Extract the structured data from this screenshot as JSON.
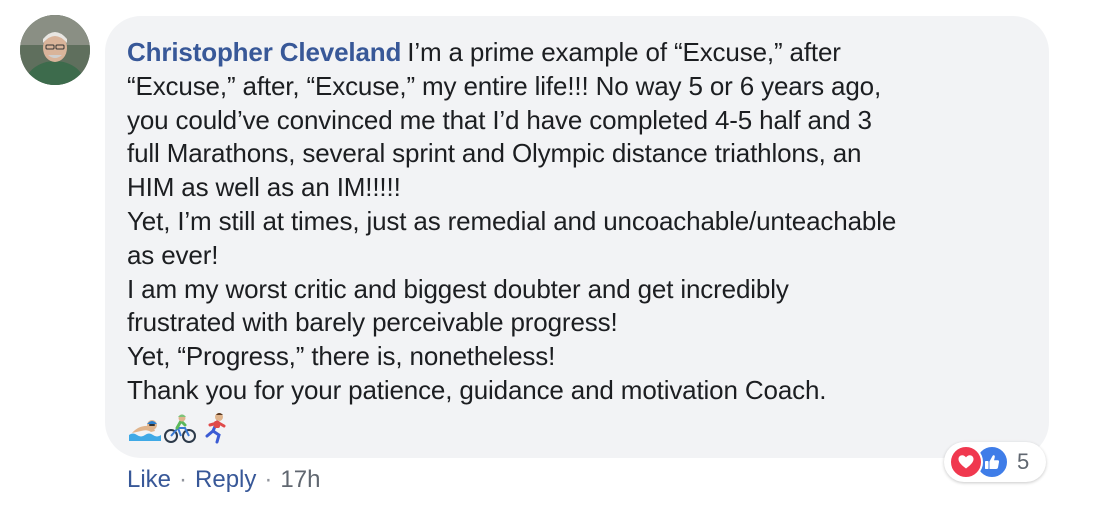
{
  "comment": {
    "author": "Christopher Cleveland",
    "lines": [
      "I’m a prime example of “Excuse,” after",
      "“Excuse,” after, “Excuse,” my entire life!!! No way 5 or 6 years ago,",
      "you could’ve convinced me that I’d have completed 4-5 half and 3",
      "full Marathons, several sprint and Olympic distance triathlons, an",
      "HIM as well as an IM!!!!!",
      "Yet, I’m still at times, just as remedial and uncoachable/unteachable",
      "as ever!",
      "I am my worst critic and biggest doubter and get incredibly",
      "frustrated with barely perceivable progress!",
      "Yet, “Progress,” there is, nonetheless!",
      "Thank you for your patience, guidance and motivation Coach."
    ],
    "emojis": [
      "swimmer-emoji",
      "cyclist-emoji",
      "runner-emoji"
    ]
  },
  "reactions": {
    "types": [
      "love",
      "like"
    ],
    "count": "5"
  },
  "actions": {
    "like_label": "Like",
    "separator": "·",
    "reply_label": "Reply",
    "time": "17h"
  },
  "colors": {
    "author_link": "#385898",
    "bubble_bg": "#f2f3f5",
    "love": "#f0384f",
    "like": "#3f7de8",
    "meta_text": "#606770"
  }
}
